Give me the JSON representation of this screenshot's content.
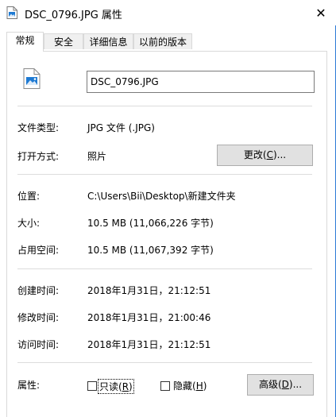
{
  "window": {
    "title": "DSC_0796.JPG 属性",
    "close_glyph": "✕"
  },
  "tabs": [
    {
      "label": "常规",
      "active": true
    },
    {
      "label": "安全",
      "active": false
    },
    {
      "label": "详细信息",
      "active": false
    },
    {
      "label": "以前的版本",
      "active": false
    }
  ],
  "general": {
    "file_name": "DSC_0796.JPG",
    "file_type_label": "文件类型:",
    "file_type_value": "JPG 文件 (.JPG)",
    "opens_with_label": "打开方式:",
    "opens_with_value": "照片",
    "change_button": {
      "prefix": "更改(",
      "accel": "C",
      "suffix": ")..."
    },
    "location_label": "位置:",
    "location_value": "C:\\Users\\Bii\\Desktop\\新建文件夹",
    "size_label": "大小:",
    "size_value": "10.5 MB (11,066,226 字节)",
    "size_on_disk_label": "占用空间:",
    "size_on_disk_value": "10.5 MB (11,067,392 字节)",
    "created_label": "创建时间:",
    "created_value": "2018年1月31日，21:12:51",
    "modified_label": "修改时间:",
    "modified_value": "2018年1月31日，21:00:46",
    "accessed_label": "访问时间:",
    "accessed_value": "2018年1月31日，21:12:51",
    "attributes_label": "属性:",
    "readonly": {
      "prefix": "只读(",
      "accel": "R",
      "suffix": ")",
      "checked": false
    },
    "hidden": {
      "prefix": "隐藏(",
      "accel": "H",
      "suffix": ")",
      "checked": false
    },
    "advanced_button": {
      "prefix": "高级(",
      "accel": "D",
      "suffix": ")..."
    }
  },
  "icons": {
    "title_icon": "image-file-icon",
    "file_icon": "image-file-icon",
    "close_icon": "close-icon"
  },
  "colors": {
    "accent": "#2c7ad6",
    "image_icon_blue": "#1e7ad3"
  }
}
